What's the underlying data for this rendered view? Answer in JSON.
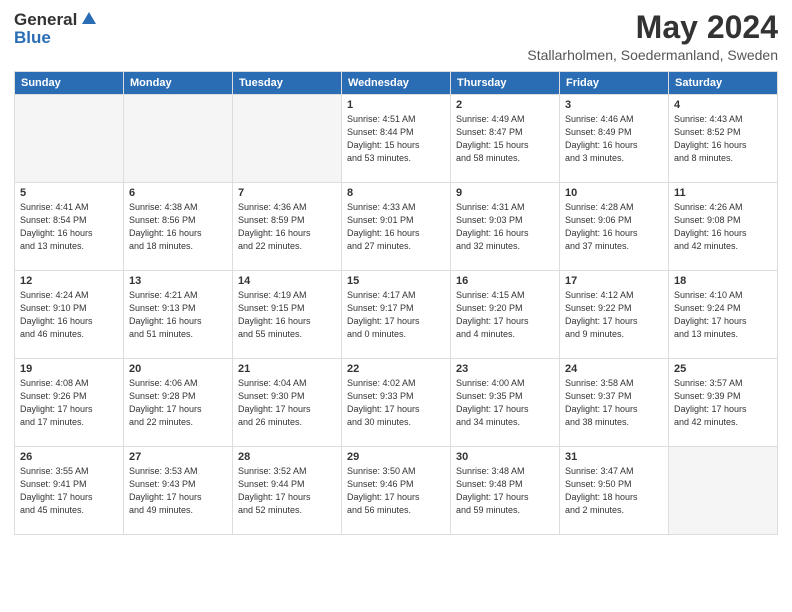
{
  "logo": {
    "general": "General",
    "blue": "Blue"
  },
  "title": "May 2024",
  "subtitle": "Stallarholmen, Soedermanland, Sweden",
  "headers": [
    "Sunday",
    "Monday",
    "Tuesday",
    "Wednesday",
    "Thursday",
    "Friday",
    "Saturday"
  ],
  "weeks": [
    [
      {
        "day": "",
        "info": ""
      },
      {
        "day": "",
        "info": ""
      },
      {
        "day": "",
        "info": ""
      },
      {
        "day": "1",
        "info": "Sunrise: 4:51 AM\nSunset: 8:44 PM\nDaylight: 15 hours\nand 53 minutes."
      },
      {
        "day": "2",
        "info": "Sunrise: 4:49 AM\nSunset: 8:47 PM\nDaylight: 15 hours\nand 58 minutes."
      },
      {
        "day": "3",
        "info": "Sunrise: 4:46 AM\nSunset: 8:49 PM\nDaylight: 16 hours\nand 3 minutes."
      },
      {
        "day": "4",
        "info": "Sunrise: 4:43 AM\nSunset: 8:52 PM\nDaylight: 16 hours\nand 8 minutes."
      }
    ],
    [
      {
        "day": "5",
        "info": "Sunrise: 4:41 AM\nSunset: 8:54 PM\nDaylight: 16 hours\nand 13 minutes."
      },
      {
        "day": "6",
        "info": "Sunrise: 4:38 AM\nSunset: 8:56 PM\nDaylight: 16 hours\nand 18 minutes."
      },
      {
        "day": "7",
        "info": "Sunrise: 4:36 AM\nSunset: 8:59 PM\nDaylight: 16 hours\nand 22 minutes."
      },
      {
        "day": "8",
        "info": "Sunrise: 4:33 AM\nSunset: 9:01 PM\nDaylight: 16 hours\nand 27 minutes."
      },
      {
        "day": "9",
        "info": "Sunrise: 4:31 AM\nSunset: 9:03 PM\nDaylight: 16 hours\nand 32 minutes."
      },
      {
        "day": "10",
        "info": "Sunrise: 4:28 AM\nSunset: 9:06 PM\nDaylight: 16 hours\nand 37 minutes."
      },
      {
        "day": "11",
        "info": "Sunrise: 4:26 AM\nSunset: 9:08 PM\nDaylight: 16 hours\nand 42 minutes."
      }
    ],
    [
      {
        "day": "12",
        "info": "Sunrise: 4:24 AM\nSunset: 9:10 PM\nDaylight: 16 hours\nand 46 minutes."
      },
      {
        "day": "13",
        "info": "Sunrise: 4:21 AM\nSunset: 9:13 PM\nDaylight: 16 hours\nand 51 minutes."
      },
      {
        "day": "14",
        "info": "Sunrise: 4:19 AM\nSunset: 9:15 PM\nDaylight: 16 hours\nand 55 minutes."
      },
      {
        "day": "15",
        "info": "Sunrise: 4:17 AM\nSunset: 9:17 PM\nDaylight: 17 hours\nand 0 minutes."
      },
      {
        "day": "16",
        "info": "Sunrise: 4:15 AM\nSunset: 9:20 PM\nDaylight: 17 hours\nand 4 minutes."
      },
      {
        "day": "17",
        "info": "Sunrise: 4:12 AM\nSunset: 9:22 PM\nDaylight: 17 hours\nand 9 minutes."
      },
      {
        "day": "18",
        "info": "Sunrise: 4:10 AM\nSunset: 9:24 PM\nDaylight: 17 hours\nand 13 minutes."
      }
    ],
    [
      {
        "day": "19",
        "info": "Sunrise: 4:08 AM\nSunset: 9:26 PM\nDaylight: 17 hours\nand 17 minutes."
      },
      {
        "day": "20",
        "info": "Sunrise: 4:06 AM\nSunset: 9:28 PM\nDaylight: 17 hours\nand 22 minutes."
      },
      {
        "day": "21",
        "info": "Sunrise: 4:04 AM\nSunset: 9:30 PM\nDaylight: 17 hours\nand 26 minutes."
      },
      {
        "day": "22",
        "info": "Sunrise: 4:02 AM\nSunset: 9:33 PM\nDaylight: 17 hours\nand 30 minutes."
      },
      {
        "day": "23",
        "info": "Sunrise: 4:00 AM\nSunset: 9:35 PM\nDaylight: 17 hours\nand 34 minutes."
      },
      {
        "day": "24",
        "info": "Sunrise: 3:58 AM\nSunset: 9:37 PM\nDaylight: 17 hours\nand 38 minutes."
      },
      {
        "day": "25",
        "info": "Sunrise: 3:57 AM\nSunset: 9:39 PM\nDaylight: 17 hours\nand 42 minutes."
      }
    ],
    [
      {
        "day": "26",
        "info": "Sunrise: 3:55 AM\nSunset: 9:41 PM\nDaylight: 17 hours\nand 45 minutes."
      },
      {
        "day": "27",
        "info": "Sunrise: 3:53 AM\nSunset: 9:43 PM\nDaylight: 17 hours\nand 49 minutes."
      },
      {
        "day": "28",
        "info": "Sunrise: 3:52 AM\nSunset: 9:44 PM\nDaylight: 17 hours\nand 52 minutes."
      },
      {
        "day": "29",
        "info": "Sunrise: 3:50 AM\nSunset: 9:46 PM\nDaylight: 17 hours\nand 56 minutes."
      },
      {
        "day": "30",
        "info": "Sunrise: 3:48 AM\nSunset: 9:48 PM\nDaylight: 17 hours\nand 59 minutes."
      },
      {
        "day": "31",
        "info": "Sunrise: 3:47 AM\nSunset: 9:50 PM\nDaylight: 18 hours\nand 2 minutes."
      },
      {
        "day": "",
        "info": ""
      }
    ]
  ]
}
